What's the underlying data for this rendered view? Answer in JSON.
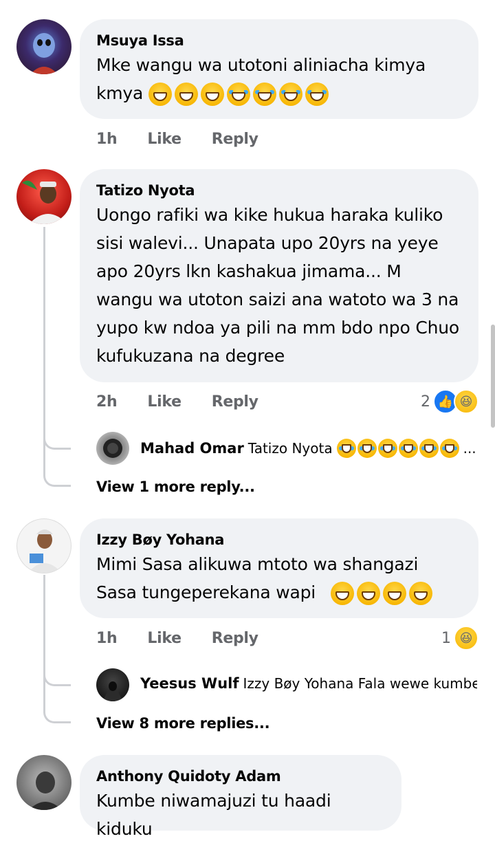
{
  "comments": [
    {
      "author": "Msuya Issa",
      "text": "Mke wangu wa utotoni aliniacha kimya kmya",
      "emoji": [
        "grin",
        "grin",
        "grin",
        "joy",
        "joy",
        "joy",
        "joy"
      ],
      "time": "1h",
      "like": "Like",
      "reply": "Reply"
    },
    {
      "author": "Tatizo Nyota",
      "text": "Uongo rafiki wa kike hukua haraka kuliko sisi walevi... Unapata upo 20yrs na yeye apo 20yrs lkn kashakua jimama... M wangu wa utoton saizi ana watoto wa 3 na yupo kw ndoa ya pili na mm bdo npo Chuo kufukuzana na degree",
      "time": "2h",
      "like": "Like",
      "reply": "Reply",
      "reaction_count": "2",
      "reply_preview": {
        "author": "Mahad Omar",
        "text": "Tatizo Nyota",
        "ellipsis": "..."
      },
      "view_more": "View 1 more reply..."
    },
    {
      "author": "Izzy Bøy Yohana",
      "text": "Mimi Sasa alikuwa mtoto wa shangazi Sasa tungeperekana wapi",
      "emoji": [
        "laugh",
        "laugh",
        "laugh",
        "laugh"
      ],
      "time": "1h",
      "like": "Like",
      "reply": "Reply",
      "reaction_count": "1",
      "reply_preview": {
        "author": "Yeesus Wulf",
        "text": "Izzy Bøy Yohana Fala wewe kumbe ..."
      },
      "view_more": "View 8 more replies..."
    },
    {
      "author": "Anthony Quidoty Adam",
      "text": "Kumbe niwamajuzi tu haadi kiduku"
    }
  ]
}
